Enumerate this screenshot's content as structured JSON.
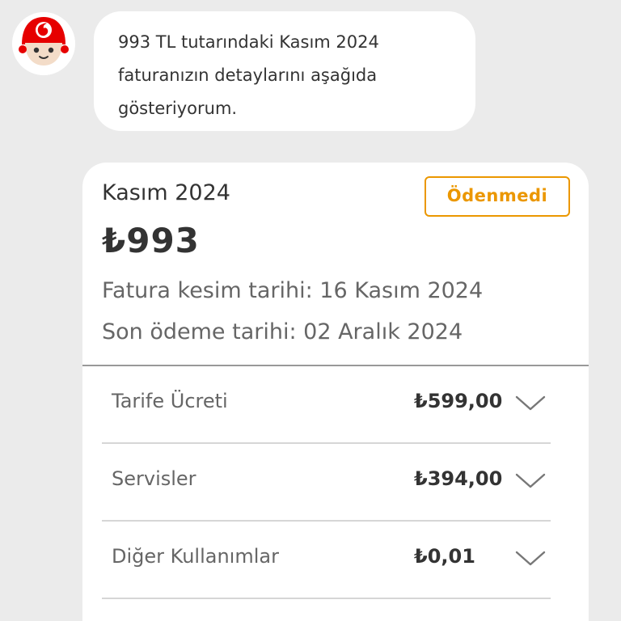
{
  "assistant": {
    "avatar_icon": "tobi-robot-avatar-icon",
    "brand_color": "#e60000",
    "message": "993 TL tutarındaki Kasım 2024 faturanızın detaylarını aşağıda gösteriyorum."
  },
  "bill": {
    "month": "Kasım 2024",
    "status": "Ödenmedi",
    "status_color": "#eb9700",
    "amount": "₺993",
    "issue_date": "Fatura kesim tarihi: 16 Kasım 2024",
    "due_date": "Son ödeme tarihi: 02 Aralık 2024",
    "items": [
      {
        "label": "Tarife Ücreti",
        "value": "₺599,00",
        "icon": "chevron-down-icon"
      },
      {
        "label": "Servisler",
        "value": "₺394,00",
        "icon": "chevron-down-icon"
      },
      {
        "label": "Diğer Kullanımlar",
        "value": "₺0,01",
        "icon": "chevron-down-icon"
      }
    ]
  }
}
